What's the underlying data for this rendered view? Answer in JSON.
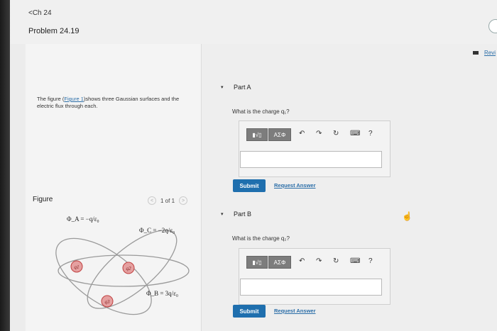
{
  "header": {
    "back_label": "<Ch 24",
    "problem_title": "Problem 24.19"
  },
  "left": {
    "intro_before": "The figure (",
    "intro_link": "Figure 1",
    "intro_after": ")shows three Gaussian surfaces and the electric flux through each.",
    "figure_label": "Figure",
    "pager_text": "1 of 1"
  },
  "figure": {
    "phi_a": "Φ_A = −q/ε₀",
    "phi_c": "Φ_C = −2q/ε₀",
    "phi_b": "Φ_B = 3q/ε₀",
    "charges": [
      "q1",
      "q2",
      "q3"
    ]
  },
  "review_label": "Revi",
  "parts": [
    {
      "toggle": "▾",
      "title": "Part A",
      "question": "What is the charge q₁?",
      "tool_math": "▮√▯",
      "tool_greek": "ΑΣΦ",
      "submit": "Submit",
      "request": "Request Answer"
    },
    {
      "toggle": "▾",
      "title": "Part B",
      "question": "What is the charge q₂?",
      "tool_math": "▮√▯",
      "tool_greek": "ΑΣΦ",
      "submit": "Submit",
      "request": "Request Answer"
    }
  ],
  "icons": [
    "undo-icon",
    "redo-icon",
    "reset-icon",
    "keyboard-icon",
    "help-icon"
  ],
  "colors": {
    "accent": "#1f6fae",
    "link": "#2b6ea8",
    "charge_fill": "#e5a0a0",
    "charge_stroke": "#c04040",
    "ellipse": "#9a9a9a"
  }
}
